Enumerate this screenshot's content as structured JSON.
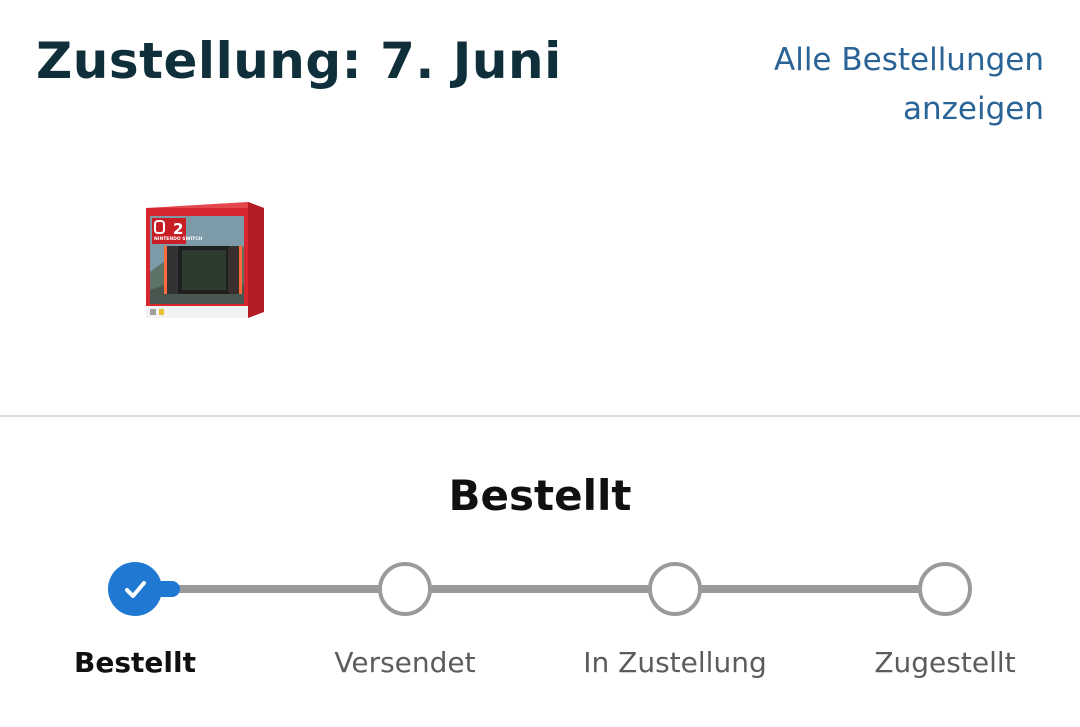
{
  "header": {
    "title": "Zustellung: 7. Juni",
    "all_orders_link": "Alle Bestellungen anzeigen"
  },
  "product": {
    "image_icon": "nintendo-switch-product-box",
    "box_logo_text": "2",
    "box_brand_text": "NINTENDO SWITCH"
  },
  "tracking": {
    "current_status": "Bestellt",
    "progress_fraction": 0.0,
    "steps": [
      {
        "label": "Bestellt",
        "state": "complete",
        "icon": "checkmark-icon"
      },
      {
        "label": "Versendet",
        "state": "pending"
      },
      {
        "label": "In Zustellung",
        "state": "pending"
      },
      {
        "label": "Zugestellt",
        "state": "pending"
      }
    ]
  },
  "colors": {
    "title": "#0f2f3a",
    "link": "#2a6496",
    "accent": "#1f78d1",
    "inactive": "#9a9a9a",
    "active_text": "#0f1111",
    "inactive_text": "#5c5c5c",
    "divider": "#dcdcdc",
    "box_red": "#d7262e"
  }
}
